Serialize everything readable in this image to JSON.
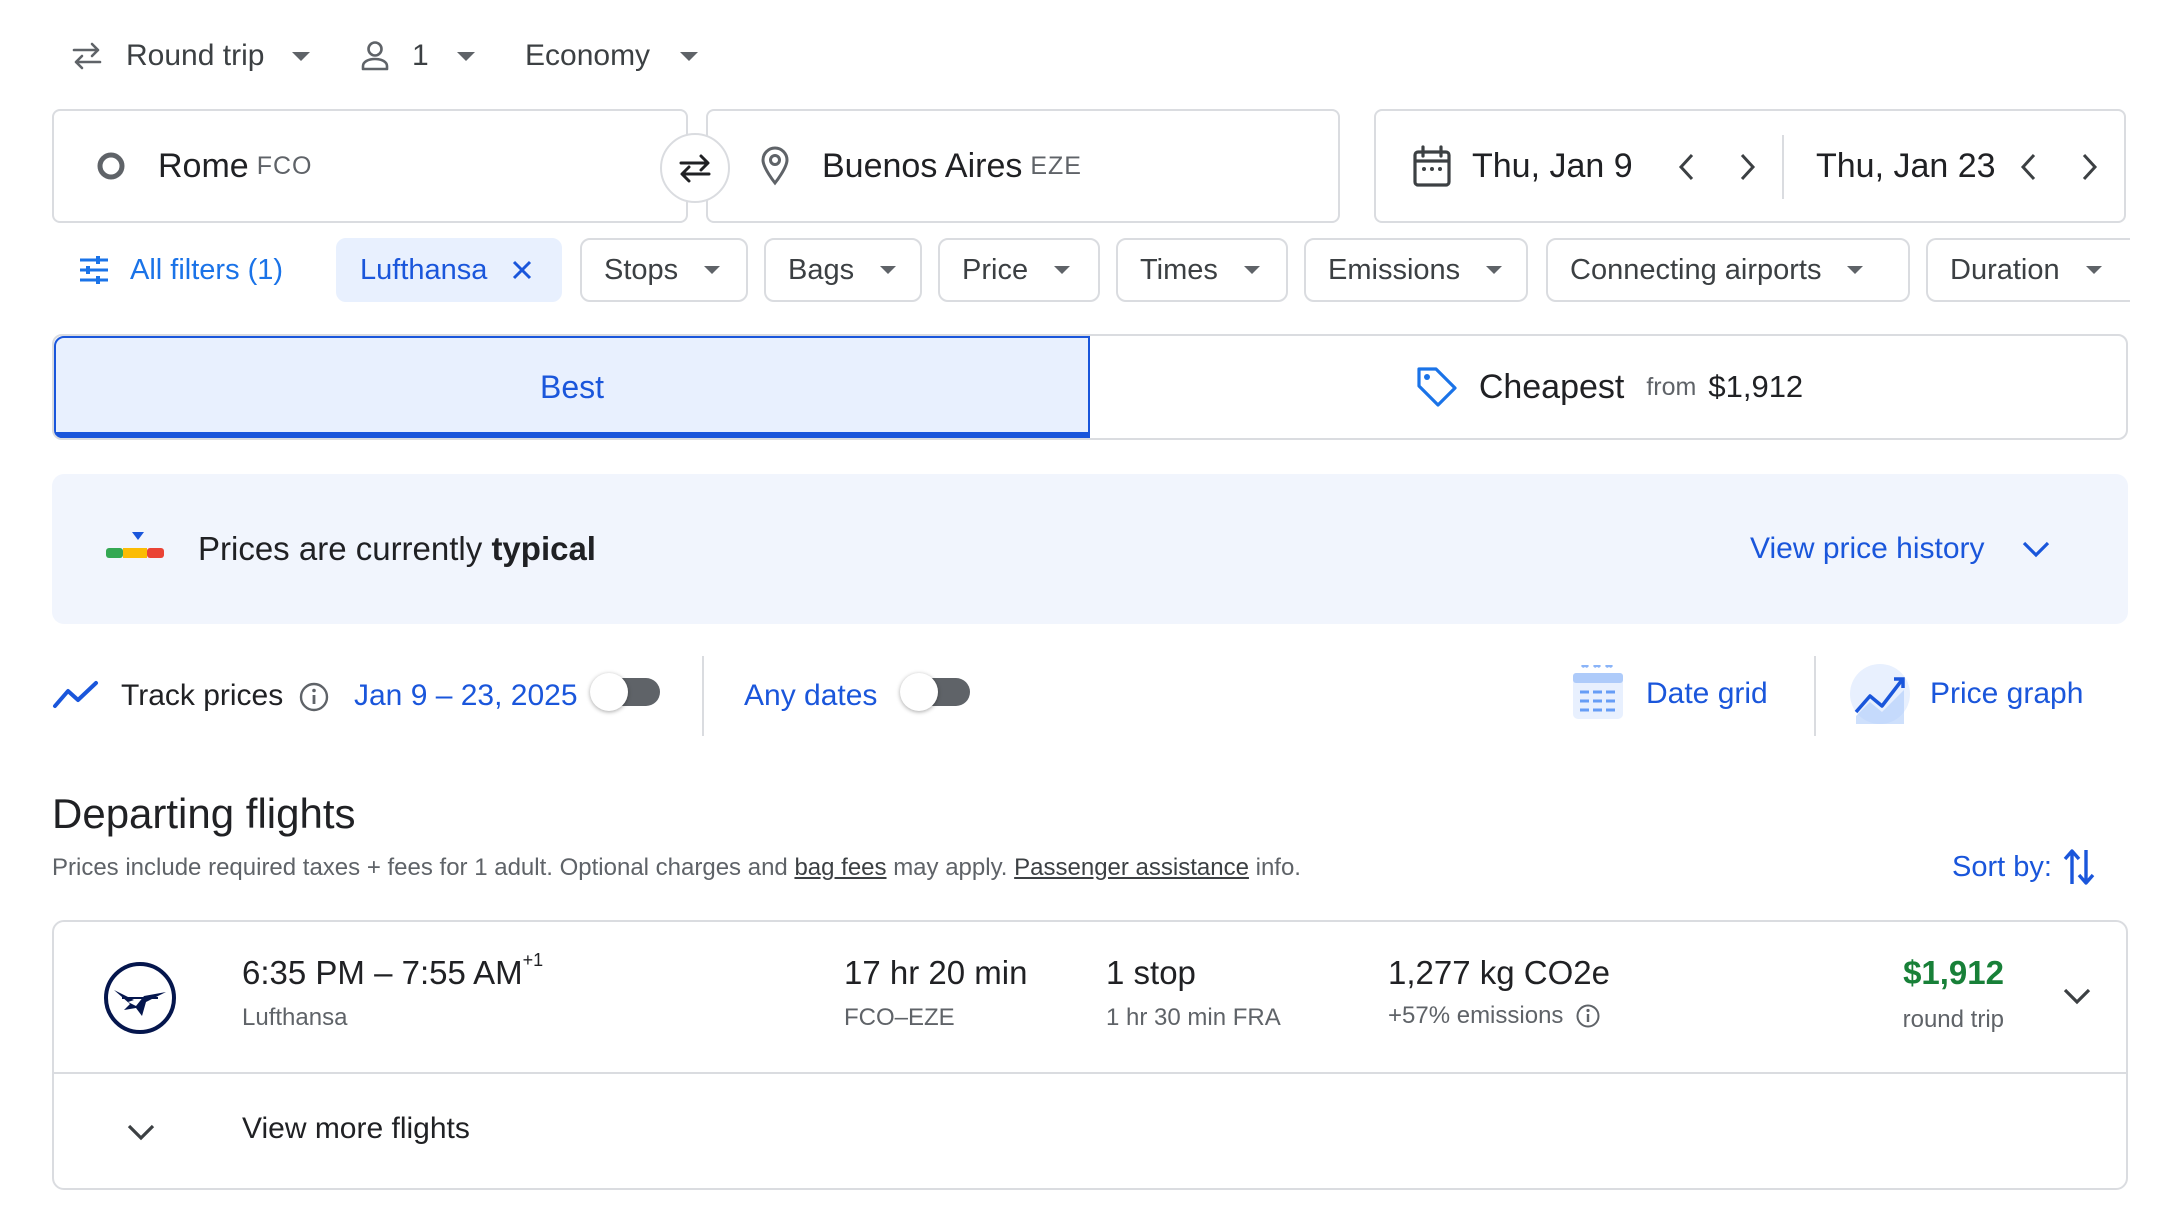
{
  "top_bar": {
    "trip_type": "Round trip",
    "passengers": "1",
    "cabin_class": "Economy"
  },
  "search": {
    "origin_city": "Rome",
    "origin_code": "FCO",
    "destination_city": "Buenos Aires",
    "destination_code": "EZE",
    "depart_date": "Thu, Jan 9",
    "return_date": "Thu, Jan 23"
  },
  "filters": {
    "all_filters": "All filters (1)",
    "airline_chip": "Lufthansa",
    "stops": "Stops",
    "bags": "Bags",
    "price": "Price",
    "times": "Times",
    "emissions": "Emissions",
    "connecting_airports": "Connecting airports",
    "duration": "Duration"
  },
  "sort_tabs": {
    "best": "Best",
    "cheapest": "Cheapest",
    "cheapest_from": "from",
    "cheapest_price": "$1,912"
  },
  "price_insight": {
    "text_prefix": "Prices are currently",
    "text_bold": "typical",
    "view_history": "View price history"
  },
  "tracking": {
    "track_prices": "Track prices",
    "date_range": "Jan 9 – 23, 2025",
    "any_dates": "Any dates",
    "date_grid": "Date grid",
    "price_graph": "Price graph"
  },
  "departing": {
    "heading": "Departing flights",
    "note_part1": "Prices include required taxes + fees for 1 adult. Optional charges and",
    "note_link1": "bag fees",
    "note_part2": "may apply.",
    "note_link2": "Passenger assistance",
    "note_part3": "info.",
    "sort_by": "Sort by:"
  },
  "flights": [
    {
      "times": "6:35 PM – 7:55 AM",
      "day_offset": "+1",
      "airline": "Lufthansa",
      "duration": "17 hr 20 min",
      "route": "FCO–EZE",
      "stops": "1 stop",
      "layover": "1 hr 30 min FRA",
      "emissions": "1,277 kg CO2e",
      "emissions_delta": "+57% emissions",
      "price": "$1,912",
      "price_type": "round trip"
    }
  ],
  "view_more": "View more flights",
  "colors": {
    "accent": "#1a73e8",
    "selected_tab_bg": "#e8f0fe",
    "price_green": "#188038",
    "insight_bg": "#f1f5fd"
  }
}
